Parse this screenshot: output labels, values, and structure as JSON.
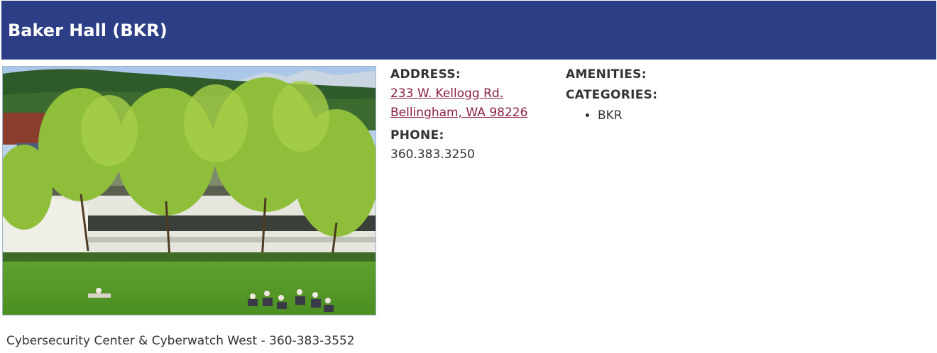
{
  "page": {
    "title": "Baker Hall (BKR)"
  },
  "photo": {
    "alt": "Baker Hall exterior with trees and lawn"
  },
  "address": {
    "label": "ADDRESS:",
    "line1": "233 W. Kellogg Rd.",
    "line2": "Bellingham, WA 98226"
  },
  "phone": {
    "label": "PHONE:",
    "value": "360.383.3250"
  },
  "amenities": {
    "label": "AMENITIES:"
  },
  "categories": {
    "label": "CATEGORIES:",
    "items": [
      "BKR"
    ]
  },
  "footer": {
    "text": "Cybersecurity Center & Cyberwatch West - 360-383-3552"
  },
  "colors": {
    "header_bg": "#2c3e85",
    "link": "#8a1e3c",
    "text": "#333333"
  }
}
